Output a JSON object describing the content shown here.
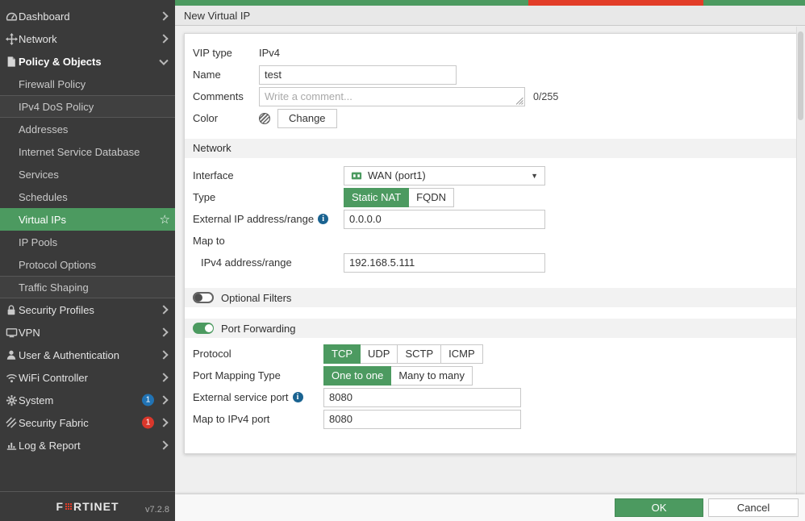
{
  "topbar": {
    "title": "New Virtual IP"
  },
  "sidebar": {
    "brand_left": "F",
    "brand_right": "RTINET",
    "version": "v7.2.8",
    "items": [
      {
        "slug": "dashboard",
        "label": "Dashboard",
        "icon": "gauge-icon",
        "child": false,
        "chevron": "right"
      },
      {
        "slug": "network",
        "label": "Network",
        "icon": "arrows-icon",
        "child": false,
        "chevron": "right"
      },
      {
        "slug": "policy-objects",
        "label": "Policy & Objects",
        "icon": "document-icon",
        "child": false,
        "chevron": "down",
        "active": true
      },
      {
        "slug": "firewall-policy",
        "label": "Firewall Policy",
        "child": true
      },
      {
        "slug": "ipv4-dos-policy",
        "label": "IPv4 DoS Policy",
        "child": true,
        "sep_top": true,
        "sep_bottom": true,
        "alt": true
      },
      {
        "slug": "addresses",
        "label": "Addresses",
        "child": true
      },
      {
        "slug": "internet-service-database",
        "label": "Internet Service Database",
        "child": true
      },
      {
        "slug": "services",
        "label": "Services",
        "child": true
      },
      {
        "slug": "schedules",
        "label": "Schedules",
        "child": true
      },
      {
        "slug": "virtual-ips",
        "label": "Virtual IPs",
        "child": true,
        "selected": true,
        "star": true
      },
      {
        "slug": "ip-pools",
        "label": "IP Pools",
        "child": true
      },
      {
        "slug": "protocol-options",
        "label": "Protocol Options",
        "child": true
      },
      {
        "slug": "traffic-shaping",
        "label": "Traffic Shaping",
        "child": true,
        "sep_top": true,
        "sep_bottom": true,
        "alt": true
      },
      {
        "slug": "security-profiles",
        "label": "Security Profiles",
        "icon": "lock-icon",
        "child": false,
        "chevron": "right"
      },
      {
        "slug": "vpn",
        "label": "VPN",
        "icon": "monitor-icon",
        "child": false,
        "chevron": "right"
      },
      {
        "slug": "user-authentication",
        "label": "User & Authentication",
        "icon": "user-icon",
        "child": false,
        "chevron": "right"
      },
      {
        "slug": "wifi-controller",
        "label": "WiFi Controller",
        "icon": "wifi-icon",
        "child": false,
        "chevron": "right"
      },
      {
        "slug": "system",
        "label": "System",
        "icon": "gear-icon",
        "child": false,
        "chevron": "right",
        "badge": {
          "text": "1",
          "color": "blue"
        }
      },
      {
        "slug": "security-fabric",
        "label": "Security Fabric",
        "icon": "fabric-icon",
        "child": false,
        "chevron": "right",
        "badge": {
          "text": "1",
          "color": "red"
        }
      },
      {
        "slug": "log-report",
        "label": "Log & Report",
        "icon": "chart-icon",
        "child": false,
        "chevron": "right"
      }
    ]
  },
  "form": {
    "vip_type": {
      "label": "VIP type",
      "value": "IPv4"
    },
    "name": {
      "label": "Name",
      "value": "test"
    },
    "comments": {
      "label": "Comments",
      "placeholder": "Write a comment...",
      "counter": "0/255"
    },
    "color": {
      "label": "Color",
      "button": "Change"
    },
    "network": {
      "section_title": "Network",
      "interface": {
        "label": "Interface",
        "value": "WAN (port1)",
        "icon": "interface-port-icon"
      },
      "type": {
        "label": "Type",
        "options": [
          {
            "label": "Static NAT",
            "selected": true
          },
          {
            "label": "FQDN",
            "selected": false
          }
        ]
      },
      "external_ip": {
        "label": "External IP address/range",
        "value": "0.0.0.0",
        "has_info": true
      },
      "map_to": {
        "label": "Map to"
      },
      "ipv4_range": {
        "label": "IPv4 address/range",
        "value": "192.168.5.111"
      }
    },
    "optional_filters": {
      "label": "Optional Filters",
      "enabled": false
    },
    "port_forwarding": {
      "label": "Port Forwarding",
      "enabled": true,
      "protocol": {
        "label": "Protocol",
        "options": [
          {
            "label": "TCP",
            "selected": true
          },
          {
            "label": "UDP",
            "selected": false
          },
          {
            "label": "SCTP",
            "selected": false
          },
          {
            "label": "ICMP",
            "selected": false
          }
        ]
      },
      "port_mapping_type": {
        "label": "Port Mapping Type",
        "options": [
          {
            "label": "One to one",
            "selected": true
          },
          {
            "label": "Many to many",
            "selected": false
          }
        ]
      },
      "external_service_port": {
        "label": "External service port",
        "value": "8080",
        "has_info": true
      },
      "map_to_port": {
        "label": "Map to IPv4 port",
        "value": "8080"
      }
    }
  },
  "footer": {
    "ok": "OK",
    "cancel": "Cancel"
  },
  "colors": {
    "accent_green": "#4c9a60",
    "alert_red": "#e23d28",
    "badge_blue": "#2173b4",
    "badge_red": "#d9372b",
    "info_blue": "#1a6391",
    "sidebar_bg": "#3a3a3a"
  }
}
